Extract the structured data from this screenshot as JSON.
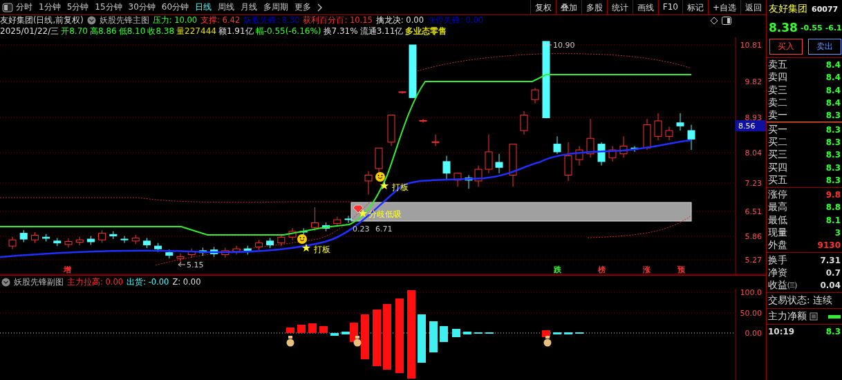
{
  "toolbar": {
    "tabs": [
      {
        "label": "分时",
        "selected": false
      },
      {
        "label": "1分钟",
        "selected": false
      },
      {
        "label": "5分钟",
        "selected": false
      },
      {
        "label": "15分钟",
        "selected": false
      },
      {
        "label": "30分钟",
        "selected": false
      },
      {
        "label": "60分钟",
        "selected": false
      },
      {
        "label": "日线",
        "selected": true
      },
      {
        "label": "周线",
        "selected": false
      },
      {
        "label": "月线",
        "selected": false
      },
      {
        "label": "多周期",
        "selected": false
      },
      {
        "label": "更多",
        "selected": false
      }
    ],
    "buttons": [
      "复权",
      "叠加",
      "多股",
      "统计",
      "画线",
      "F10",
      "标记",
      "+自选",
      "返回"
    ]
  },
  "main_chart": {
    "title": "友好集团(日线,前复权)",
    "indicator": "妖股先锋主图",
    "indicator_values": [
      {
        "text": "压力: 10.00",
        "color": "#33ff33"
      },
      {
        "text": "支撑: 6.42",
        "color": "#ff3232"
      },
      {
        "text": "妖股先锋: 8.30",
        "color": "#0000c8"
      },
      {
        "text": "获利百分百: 10.15",
        "color": "#ff3232"
      },
      {
        "text": "擒龙决: 0.00",
        "color": "#e0e0e0"
      },
      {
        "text": "涨停先锋: 0.00",
        "color": "#0000c8"
      }
    ],
    "bar_info": [
      {
        "text": "2025/01/22/三",
        "color": "#e0e0e0"
      },
      {
        "text": "开8.70",
        "color": "#33ff33"
      },
      {
        "text": "高8.86",
        "color": "#33ff33"
      },
      {
        "text": "低8.10",
        "color": "#33ff33"
      },
      {
        "text": "收8.38",
        "color": "#33ff33"
      },
      {
        "text": "量227444",
        "color": "#e0e000"
      },
      {
        "text": "额1.91亿",
        "color": "#e0e0e0"
      },
      {
        "text": "幅-0.55(-6.16%)",
        "color": "#33ff33"
      },
      {
        "text": "换7.31%",
        "color": "#e0e0e0"
      },
      {
        "text": "流通3.11亿",
        "color": "#e0e0e0"
      },
      {
        "text": "多业态零售",
        "color": "#e0e000"
      }
    ],
    "y_axis": [
      "10.81",
      "9.82",
      "8.93",
      "8.04",
      "7.23",
      "6.51",
      "5.86",
      "5.27"
    ],
    "price_tag": "8.56",
    "annotations": [
      {
        "kind": "high",
        "text": "10.90"
      },
      {
        "kind": "low",
        "text": "5.15"
      },
      {
        "kind": "buy_signal",
        "text": "打板"
      },
      {
        "kind": "buy_signal",
        "text": "打板"
      },
      {
        "kind": "band_signal",
        "text": "分歧低吸"
      },
      {
        "kind": "value",
        "text": "0.23"
      },
      {
        "kind": "value",
        "text": "6.71"
      }
    ],
    "markers": [
      {
        "text": "增",
        "color": "#ff3232"
      },
      {
        "text": "跌",
        "color": "#33ff33"
      },
      {
        "text": "榜",
        "color": "#ff3232"
      },
      {
        "text": "涨",
        "color": "#ff3232"
      },
      {
        "text": "预",
        "color": "#ff3232"
      }
    ]
  },
  "sub_chart": {
    "indicator": "妖股先锋副图",
    "values": [
      {
        "text": "主力拉高: 0.00",
        "color": "#ff3232"
      },
      {
        "text": "出货: -0.00",
        "color": "#54ffff"
      },
      {
        "text": "Z: 0.00",
        "color": "#e0e0e0"
      }
    ],
    "y_axis": [
      "100.0",
      "50.00",
      "0.00"
    ]
  },
  "quote_panel": {
    "name": "友好集团",
    "code": "60077",
    "price": "8.38",
    "change": "-0.55",
    "change_pct": "-6.1",
    "buttons": [
      {
        "label": "买入",
        "kind": "buy"
      },
      {
        "label": "卖出",
        "kind": "sell"
      }
    ],
    "asks": [
      {
        "label": "卖五",
        "price": "8.4"
      },
      {
        "label": "卖四",
        "price": "8.4"
      },
      {
        "label": "卖三",
        "price": "8.4"
      },
      {
        "label": "卖二",
        "price": "8.4"
      },
      {
        "label": "卖一",
        "price": "8.3"
      }
    ],
    "bids": [
      {
        "label": "买一",
        "price": "8.3"
      },
      {
        "label": "买二",
        "price": "8.3"
      },
      {
        "label": "买三",
        "price": "8.3"
      },
      {
        "label": "买四",
        "price": "8.3"
      },
      {
        "label": "买五",
        "price": "8.3"
      }
    ],
    "stats": [
      {
        "label": "涨停",
        "value": "9.8",
        "color": "#ff3232"
      },
      {
        "label": "最高",
        "value": "8.8",
        "color": "#33ff33"
      },
      {
        "label": "最低",
        "value": "8.1",
        "color": "#33ff33"
      },
      {
        "label": "现量",
        "value": "3",
        "color": "#33ff33"
      },
      {
        "label": "外盘",
        "value": "9130",
        "color": "#ff3232"
      }
    ],
    "fundamentals": [
      {
        "label": "换手",
        "value": "7.31"
      },
      {
        "label": "净资",
        "value": "0.7"
      },
      {
        "label": "收益㈢",
        "value": "0.04"
      }
    ],
    "trade_status": "交易状态: 连续",
    "net_flow": "主力净额",
    "tick": {
      "time": "10:19",
      "price": "8.3"
    }
  }
}
